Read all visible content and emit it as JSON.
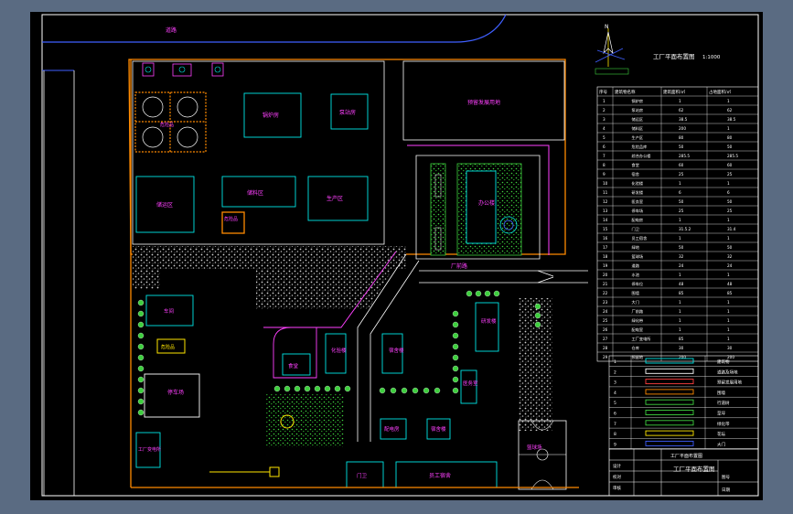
{
  "title_block": {
    "main_title": "工厂平面布置图",
    "scale": "1:1000",
    "small_title": "工厂平面布置图"
  },
  "compass": {
    "label": "N"
  },
  "map_labels": {
    "road_top": "道路",
    "boiler": "锅炉房",
    "pump": "泵站房",
    "reserved_land": "预留发展用地",
    "storage": "储运区",
    "warehouse": "储料区",
    "production": "生产区",
    "small_box": "危险品",
    "office_building": "办公楼",
    "canteen": "食堂",
    "dorm_a": "宿舍楼",
    "dorm_b": "宿舍楼",
    "lab": "化验楼",
    "research": "研发楼",
    "hospital": "医务室",
    "workshop": "车间",
    "parking": "停车场",
    "power": "配电房",
    "gate_house": "门卫",
    "staff": "员工宿舍",
    "fitness": "篮球场",
    "main_road": "厂前路",
    "factory": "工厂变电所"
  },
  "table_headers": [
    "序号",
    "建筑物名称",
    "建筑面积/㎡",
    "占地面积/㎡"
  ],
  "table_rows": [
    [
      "1",
      "锅炉房",
      "1",
      "1"
    ],
    [
      "2",
      "泵站房",
      "62",
      "62"
    ],
    [
      "3",
      "储运区",
      "38.5",
      "38.5"
    ],
    [
      "4",
      "储料区",
      "200",
      "1"
    ],
    [
      "5",
      "生产区",
      "80",
      "80"
    ],
    [
      "6",
      "危险品库",
      "50",
      "50"
    ],
    [
      "7",
      "综合办公楼",
      "285.5",
      "285.5"
    ],
    [
      "8",
      "食堂",
      "60",
      "60"
    ],
    [
      "9",
      "宿舍",
      "25",
      "25"
    ],
    [
      "10",
      "化验楼",
      "1",
      "1"
    ],
    [
      "11",
      "研发楼",
      "6",
      "6"
    ],
    [
      "12",
      "医务室",
      "50",
      "50"
    ],
    [
      "13",
      "停车场",
      "25",
      "25"
    ],
    [
      "14",
      "配电房",
      "1",
      "1"
    ],
    [
      "15",
      "门卫",
      "31.5.2",
      "31.4"
    ],
    [
      "16",
      "员工宿舍",
      "1",
      "1"
    ],
    [
      "17",
      "绿地",
      "50",
      "50"
    ],
    [
      "18",
      "篮球场",
      "32",
      "32"
    ],
    [
      "19",
      "道路",
      "24",
      "24"
    ],
    [
      "20",
      "水池",
      "1",
      "1"
    ],
    [
      "21",
      "停车位",
      "48",
      "48"
    ],
    [
      "22",
      "围墙",
      "85",
      "85"
    ],
    [
      "23",
      "大门",
      "1",
      "1"
    ],
    [
      "24",
      "厂前路",
      "1",
      "1"
    ],
    [
      "25",
      "绿化带",
      "1",
      "1"
    ],
    [
      "26",
      "配电室",
      "1",
      "1"
    ],
    [
      "27",
      "工厂变电所",
      "85",
      "1"
    ],
    [
      "28",
      "仓库",
      "30",
      "30"
    ],
    [
      "29",
      "预留地",
      "200",
      "200"
    ]
  ],
  "legend_rows": [
    [
      "1",
      "建筑物"
    ],
    [
      "2",
      "道路及场地"
    ],
    [
      "3",
      "预留发展用地"
    ],
    [
      "4",
      "围墙"
    ],
    [
      "5",
      "行道树"
    ],
    [
      "6",
      "草坪"
    ],
    [
      "7",
      "绿化带"
    ],
    [
      "8",
      "花坛"
    ],
    [
      "9",
      "大门"
    ]
  ],
  "bottom_block": {
    "col1": "设计",
    "col2": "校对",
    "col3": "审核",
    "sheet": "图号",
    "date": "日期"
  }
}
